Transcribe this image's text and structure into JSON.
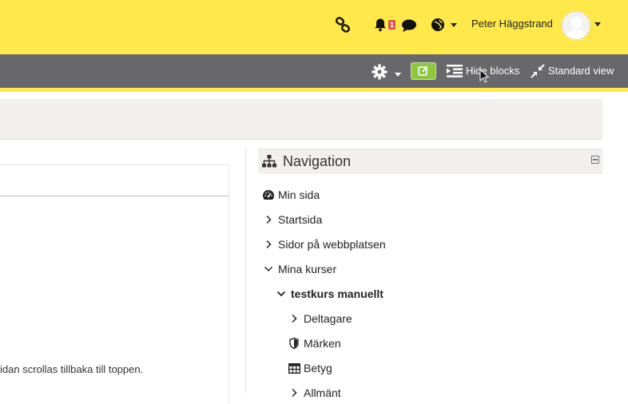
{
  "topbar": {
    "user_name": "Peter Häggstrand",
    "notification_count": "1",
    "icons": [
      "link-icon",
      "bell-icon",
      "message-icon",
      "globe-icon",
      "avatar",
      "user-menu-caret"
    ]
  },
  "navbar": {
    "hide_blocks_label": "Hide blocks",
    "standard_view_label": "Standard view",
    "icons": [
      "gear-icon",
      "edit-icon",
      "hide-blocks-icon",
      "compress-icon"
    ]
  },
  "main": {
    "scroll_text": "idan scrollas tillbaka till toppen."
  },
  "navigation_block": {
    "title": "Navigation",
    "items": [
      {
        "label": "Min sida",
        "icon": "dashboard-icon"
      },
      {
        "label": "Startsida",
        "icon": "chevron-right-icon"
      },
      {
        "label": "Sidor på webbplatsen",
        "icon": "chevron-right-icon"
      },
      {
        "label": "Mina kurser",
        "icon": "chevron-down-icon"
      },
      {
        "label": "testkurs manuellt",
        "icon": "chevron-down-icon"
      },
      {
        "label": "Deltagare",
        "icon": "chevron-right-icon"
      },
      {
        "label": "Märken",
        "icon": "shield-icon"
      },
      {
        "label": "Betyg",
        "icon": "table-icon"
      },
      {
        "label": "Allmänt",
        "icon": "chevron-right-icon"
      }
    ]
  },
  "colors": {
    "topbar_bg": "#ffe84a",
    "navbar_bg": "#68686c",
    "edit_button": "#8dc63f",
    "badge": "#d9534f"
  }
}
